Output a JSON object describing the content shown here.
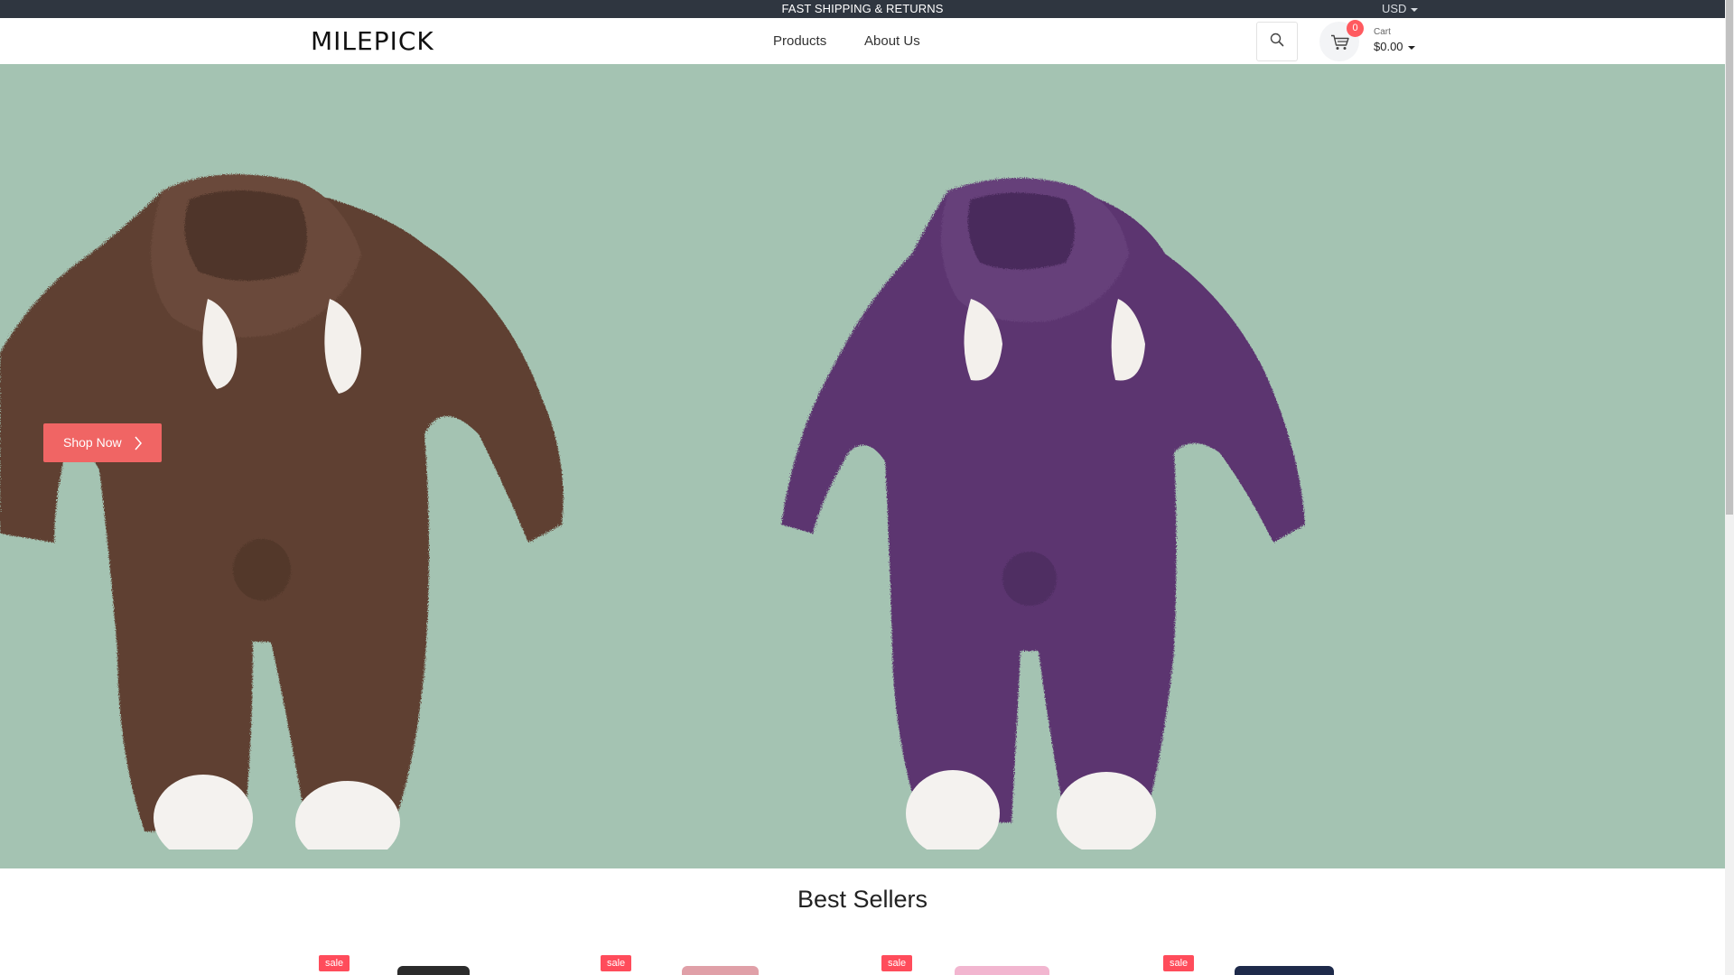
{
  "announcement": {
    "text": "FAST SHIPPING & RETURNS",
    "currency": "USD"
  },
  "header": {
    "logo": "MILEPICK",
    "nav": [
      "Products",
      "About Us"
    ],
    "search_icon": "search-icon",
    "cart": {
      "icon": "cart-icon",
      "count": "0",
      "label": "Cart",
      "total": "$0.00"
    }
  },
  "hero": {
    "background_color": "#a4c3b2",
    "cta_label": "Shop Now",
    "cta_icon": "chevron-right-icon",
    "cta_color": "#f06564",
    "images": [
      "brown-fleece-bunny-romper",
      "purple-fleece-bunny-romper"
    ]
  },
  "best_sellers": {
    "title": "Best Sellers",
    "products": [
      {
        "badge": "sale"
      },
      {
        "badge": "sale"
      },
      {
        "badge": "sale"
      },
      {
        "badge": "sale"
      }
    ]
  },
  "colors": {
    "topbar": "#2f3640",
    "badge": "#ff4c5b"
  }
}
